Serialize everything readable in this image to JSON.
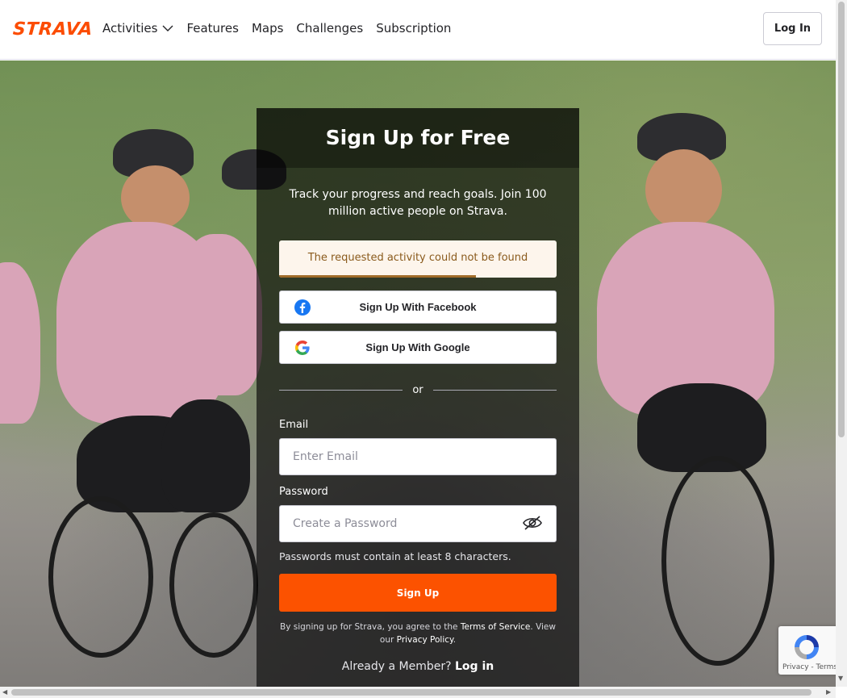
{
  "header": {
    "logo": "STRAVA",
    "nav": [
      {
        "label": "Activities",
        "has_dropdown": true
      },
      {
        "label": "Features"
      },
      {
        "label": "Maps"
      },
      {
        "label": "Challenges"
      },
      {
        "label": "Subscription"
      }
    ],
    "login_label": "Log In"
  },
  "card": {
    "title": "Sign Up for Free",
    "tagline": "Track your progress and reach goals. Join 100 million active people on Strava.",
    "alert": {
      "text": "The requested activity could not be found",
      "progress": 0.71
    },
    "facebook_label": "Sign Up With Facebook",
    "google_label": "Sign Up With Google",
    "or_label": "or",
    "email_label": "Email",
    "email_placeholder": "Enter Email",
    "email_value": "",
    "password_label": "Password",
    "password_placeholder": "Create a Password",
    "password_value": "",
    "password_hint": "Passwords must contain at least 8 characters.",
    "signup_label": "Sign Up",
    "legal_prefix": "By signing up for Strava, you agree to the",
    "terms_link": "Terms of Service",
    "legal_mid": ". View our",
    "privacy_link": "Privacy Policy",
    "legal_suffix": ".",
    "already_text": "Already a Member?",
    "login_link": "Log in"
  },
  "recaptcha": {
    "privacy": "Privacy",
    "separator": "-",
    "terms": "Terms"
  },
  "colors": {
    "brand": "#fc4c02",
    "signup_button": "#fc5200",
    "alert_bg": "#fdf5ec"
  }
}
